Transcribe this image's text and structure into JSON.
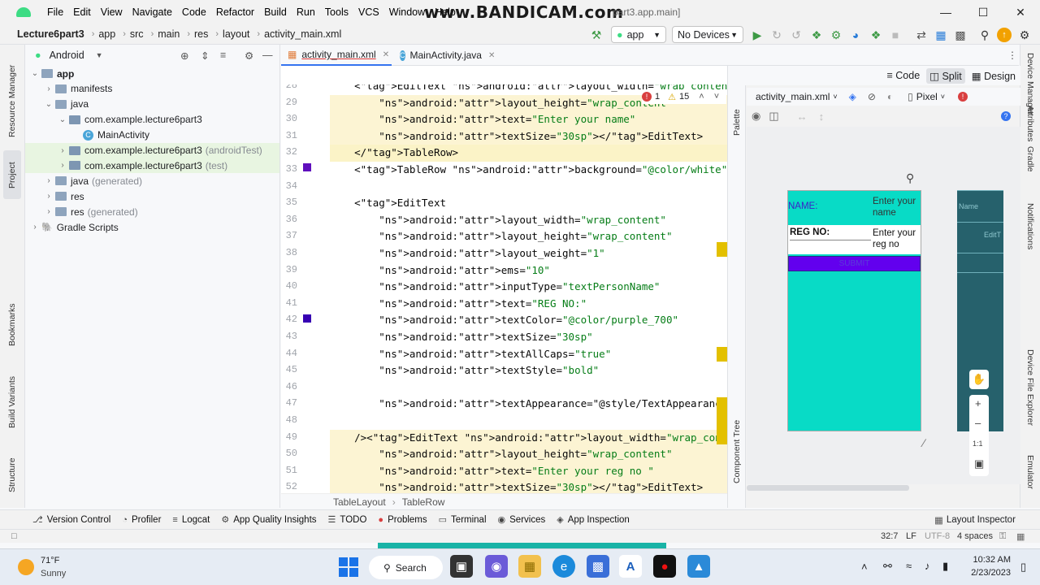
{
  "window": {
    "menu": [
      "File",
      "Edit",
      "View",
      "Navigate",
      "Code",
      "Refactor",
      "Build",
      "Run",
      "Tools",
      "VCS",
      "Window",
      "Help"
    ],
    "watermark": "www.BANDICAM.com",
    "title_tail": "part3.app.main]"
  },
  "navbar": {
    "breadcrumbs": [
      "Lecture6part3",
      "app",
      "src",
      "main",
      "res",
      "layout",
      "activity_main.xml"
    ],
    "run_config": "app",
    "device": "No Devices"
  },
  "left_strip": [
    "Resource Manager",
    "Project",
    "Bookmarks",
    "Build Variants",
    "Structure"
  ],
  "right_strip": [
    "Device Manager",
    "Attributes",
    "Gradle",
    "Notifications",
    "Device File Explorer",
    "Emulator"
  ],
  "project": {
    "view": "Android",
    "tree": [
      {
        "label": "app",
        "suffix": "",
        "depth": 0,
        "icon": "folder"
      },
      {
        "label": "manifests",
        "suffix": "",
        "depth": 1,
        "icon": "folder"
      },
      {
        "label": "java",
        "suffix": "",
        "depth": 1,
        "icon": "folder"
      },
      {
        "label": "com.example.lecture6part3",
        "suffix": "",
        "depth": 2,
        "icon": "package"
      },
      {
        "label": "MainActivity",
        "suffix": "",
        "depth": 3,
        "icon": "class"
      },
      {
        "label": "com.example.lecture6part3",
        "suffix": "(androidTest)",
        "depth": 2,
        "icon": "package"
      },
      {
        "label": "com.example.lecture6part3",
        "suffix": "(test)",
        "depth": 2,
        "icon": "package"
      },
      {
        "label": "java",
        "suffix": "(generated)",
        "depth": 1,
        "icon": "folder"
      },
      {
        "label": "res",
        "suffix": "",
        "depth": 1,
        "icon": "folder"
      },
      {
        "label": "res",
        "suffix": "(generated)",
        "depth": 1,
        "icon": "folder"
      },
      {
        "label": "Gradle Scripts",
        "suffix": "",
        "depth": 0,
        "icon": "gradle"
      }
    ]
  },
  "tabs": [
    {
      "label": "activity_main.xml",
      "active": true
    },
    {
      "label": "MainActivity.java",
      "active": false
    }
  ],
  "editor": {
    "inspections": {
      "errors": "1",
      "warnings": "15"
    },
    "lines": [
      {
        "n": "28",
        "text": "    <EditText android:layout_width=\"wrap_content\""
      },
      {
        "n": "29",
        "text": "        android:layout_height=\"wrap_content\""
      },
      {
        "n": "30",
        "text": "        android:text=\"Enter your name\""
      },
      {
        "n": "31",
        "text": "        android:textSize=\"30sp\"></EditText>"
      },
      {
        "n": "32",
        "text": "    </TableRow>"
      },
      {
        "n": "33",
        "text": "    <TableRow android:background=\"@color/white\">"
      },
      {
        "n": "34",
        "text": ""
      },
      {
        "n": "35",
        "text": "    <EditText"
      },
      {
        "n": "36",
        "text": "        android:layout_width=\"wrap_content\""
      },
      {
        "n": "37",
        "text": "        android:layout_height=\"wrap_content\""
      },
      {
        "n": "38",
        "text": "        android:layout_weight=\"1\""
      },
      {
        "n": "39",
        "text": "        android:ems=\"10\""
      },
      {
        "n": "40",
        "text": "        android:inputType=\"textPersonName\""
      },
      {
        "n": "41",
        "text": "        android:text=\"REG NO:\""
      },
      {
        "n": "42",
        "text": "        android:textColor=\"@color/purple_700\""
      },
      {
        "n": "43",
        "text": "        android:textSize=\"30sp\""
      },
      {
        "n": "44",
        "text": "        android:textAllCaps=\"true\""
      },
      {
        "n": "45",
        "text": "        android:textStyle=\"bold\""
      },
      {
        "n": "46",
        "text": ""
      },
      {
        "n": "47",
        "text": "        android:textAppearance=\"@style/TextAppearance.AppCompat"
      },
      {
        "n": "48",
        "text": ""
      },
      {
        "n": "49",
        "text": "    /><EditText android:layout_width=\"wrap_content\""
      },
      {
        "n": "50",
        "text": "        android:layout_height=\"wrap_content\""
      },
      {
        "n": "51",
        "text": "        android:text=\"Enter your reg no \""
      },
      {
        "n": "52",
        "text": "        android:textSize=\"30sp\"></EditText>"
      }
    ],
    "breadcrumb": [
      "TableLayout",
      "TableRow"
    ]
  },
  "design": {
    "modes": [
      "Code",
      "Split",
      "Design"
    ],
    "file": "activity_main.xml",
    "device": "Pixel",
    "palette_label": "Palette",
    "tree_label": "Component Tree",
    "preview": {
      "name_label": "NAME:",
      "name_hint": "Enter your name",
      "reg_label": "REG NO:",
      "reg_hint": "Enter your reg no",
      "button": "SUBMIT",
      "blueprint_1": "Name",
      "blueprint_2": "EditT"
    },
    "zoom_ratio": "1:1"
  },
  "bottom_tools": [
    "Version Control",
    "Profiler",
    "Logcat",
    "App Quality Insights",
    "TODO",
    "Problems",
    "Terminal",
    "Services",
    "App Inspection"
  ],
  "layout_inspector": "Layout Inspector",
  "status": {
    "position": "32:7",
    "line_sep": "LF",
    "encoding": "UTF-8",
    "indent": "4 spaces"
  },
  "taskbar": {
    "weather_temp": "71°F",
    "weather_desc": "Sunny",
    "search": "Search",
    "time": "10:32 AM",
    "date": "2/23/2023"
  }
}
